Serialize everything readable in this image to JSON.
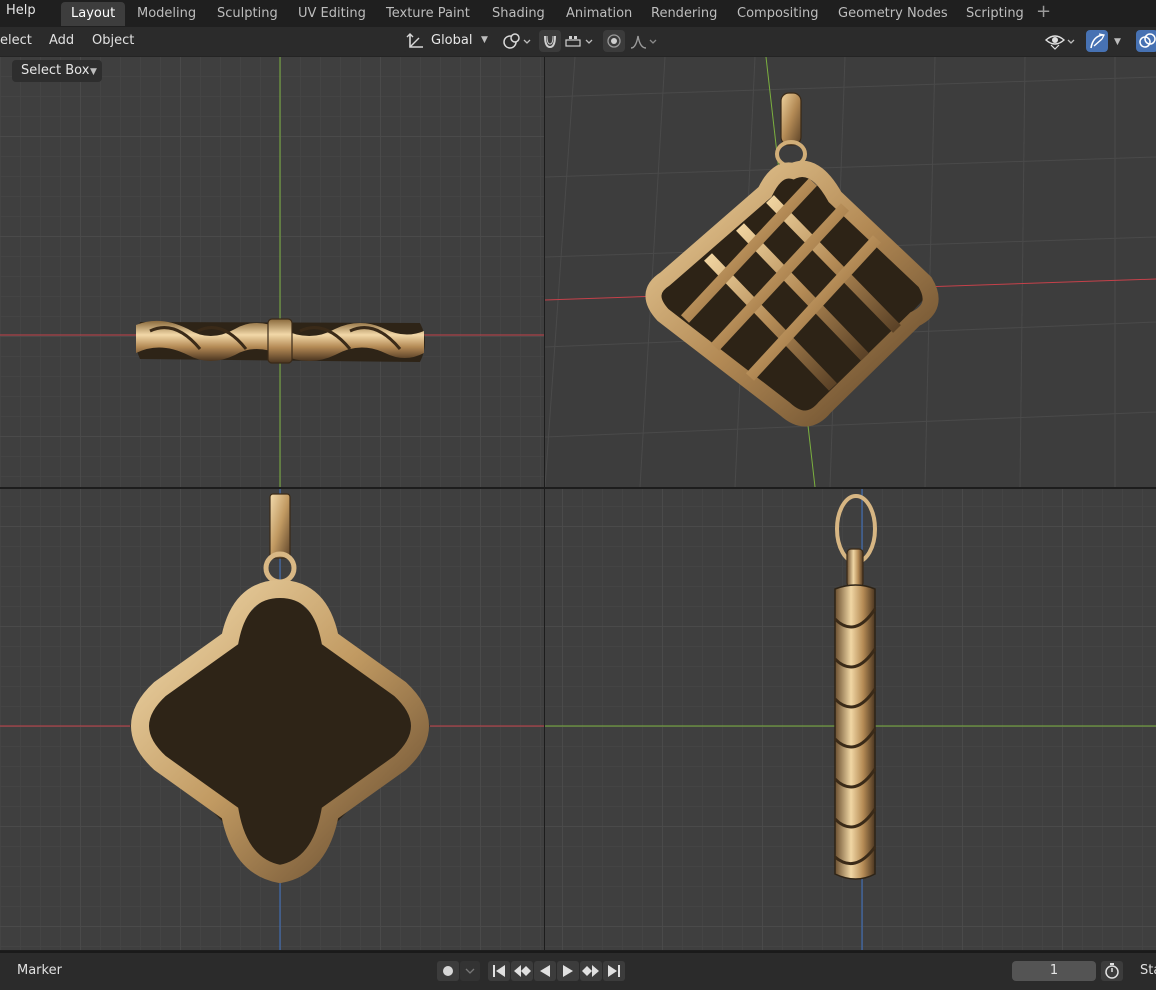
{
  "topbar": {
    "help_label": "Help",
    "workspaces": [
      "Layout",
      "Modeling",
      "Sculpting",
      "UV Editing",
      "Texture Paint",
      "Shading",
      "Animation",
      "Rendering",
      "Compositing",
      "Geometry Nodes",
      "Scripting"
    ],
    "active_workspace": "Layout",
    "add_workspace_icon": "plus-icon"
  },
  "header": {
    "menus": [
      "elect",
      "Add",
      "Object"
    ],
    "orientation": "Global",
    "orientation_icon": "transform-orientation-icon",
    "pivot_icon": "pivot-point-icon",
    "snap_icon": "magnet-snap-icon",
    "snap_target_icon": "snap-increment-icon",
    "proportional_icon": "proportional-edit-icon",
    "falloff_icon": "falloff-curve-icon",
    "visibility_icon": "eye-icon",
    "gizmo_icon": "gizmo-icon",
    "overlay_icon": "overlay-icon"
  },
  "tool_settings": {
    "select_mode": "Select Box"
  },
  "timeline": {
    "marker_label": "Marker",
    "current_frame": "1",
    "start_label": "Sta",
    "record_icon": "record-icon",
    "playback_icons": [
      "jump-start-icon",
      "prev-keyframe-icon",
      "play-reverse-icon",
      "play-icon",
      "next-keyframe-icon",
      "jump-end-icon"
    ],
    "timer_icon": "stopwatch-icon"
  },
  "colors": {
    "accent": "#4772b3",
    "x_axis": "#c5414a",
    "y_axis": "#7bb03f",
    "z_axis": "#3e73c6",
    "gold": "#c9a46a"
  }
}
